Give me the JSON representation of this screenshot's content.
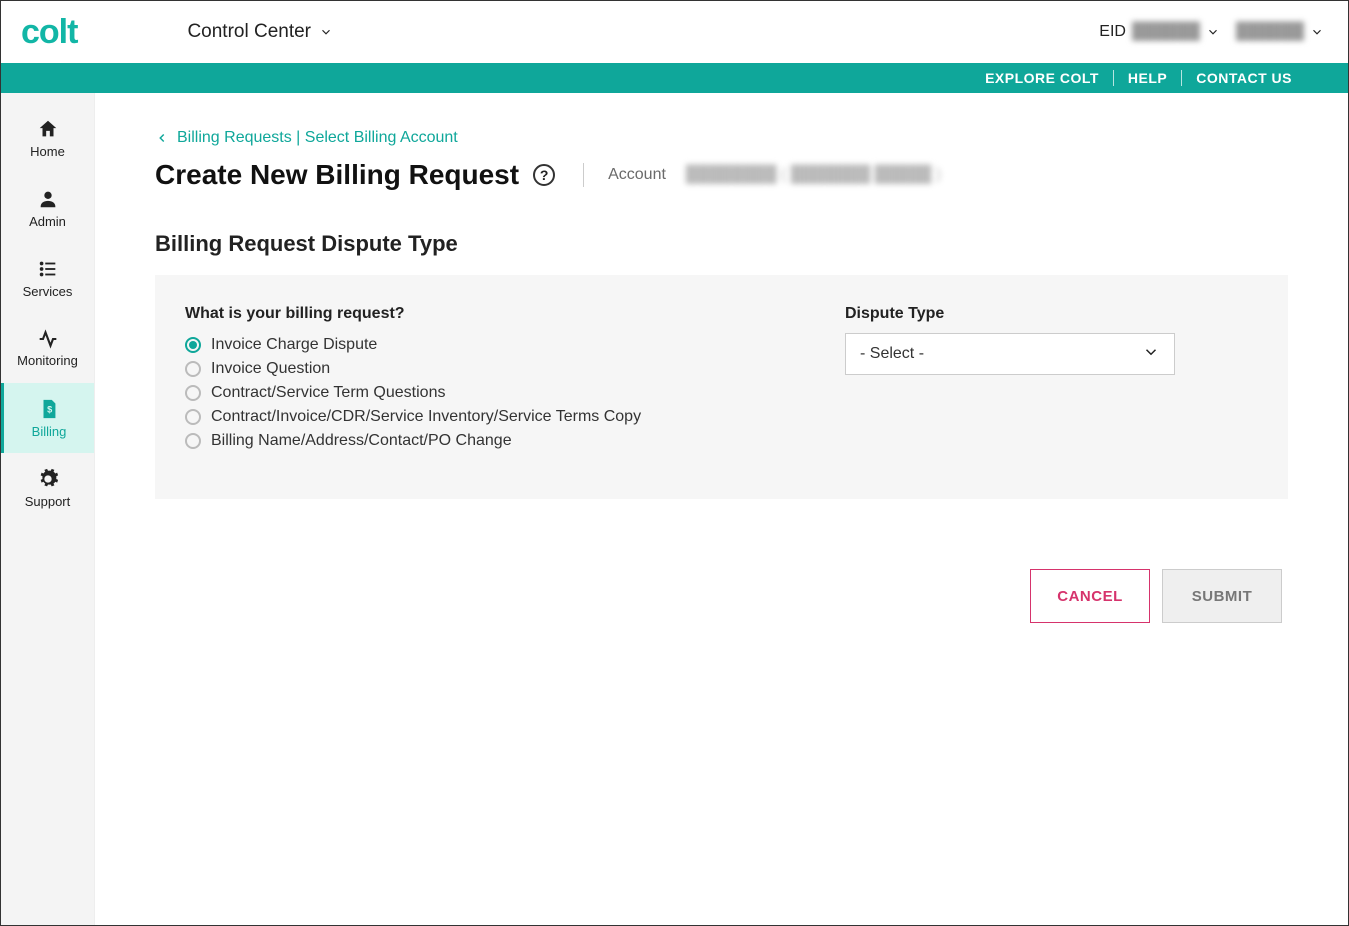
{
  "brand": "colt",
  "header": {
    "app_switcher": "Control Center",
    "eid_label": "EID",
    "eid_value": "██████",
    "user_name": "██████"
  },
  "tealbar": {
    "explore": "EXPLORE COLT",
    "help": "HELP",
    "contact": "CONTACT US"
  },
  "sidebar": {
    "items": [
      {
        "key": "home",
        "label": "Home"
      },
      {
        "key": "admin",
        "label": "Admin"
      },
      {
        "key": "services",
        "label": "Services"
      },
      {
        "key": "monitoring",
        "label": "Monitoring"
      },
      {
        "key": "billing",
        "label": "Billing"
      },
      {
        "key": "support",
        "label": "Support"
      }
    ],
    "active": "billing"
  },
  "breadcrumb": "Billing Requests | Select Billing Account",
  "page_title": "Create New Billing Request",
  "account_label": "Account",
  "account_value": "████████ ( ███████ █████ )",
  "section_title": "Billing Request Dispute Type",
  "form": {
    "question": "What is your billing request?",
    "options": [
      "Invoice Charge Dispute",
      "Invoice Question",
      "Contract/Service Term Questions",
      "Contract/Invoice/CDR/Service Inventory/Service Terms Copy",
      "Billing Name/Address/Contact/PO Change"
    ],
    "selected_index": 0,
    "dispute_type_label": "Dispute Type",
    "dispute_type_value": "- Select -"
  },
  "buttons": {
    "cancel": "CANCEL",
    "submit": "SUBMIT"
  }
}
